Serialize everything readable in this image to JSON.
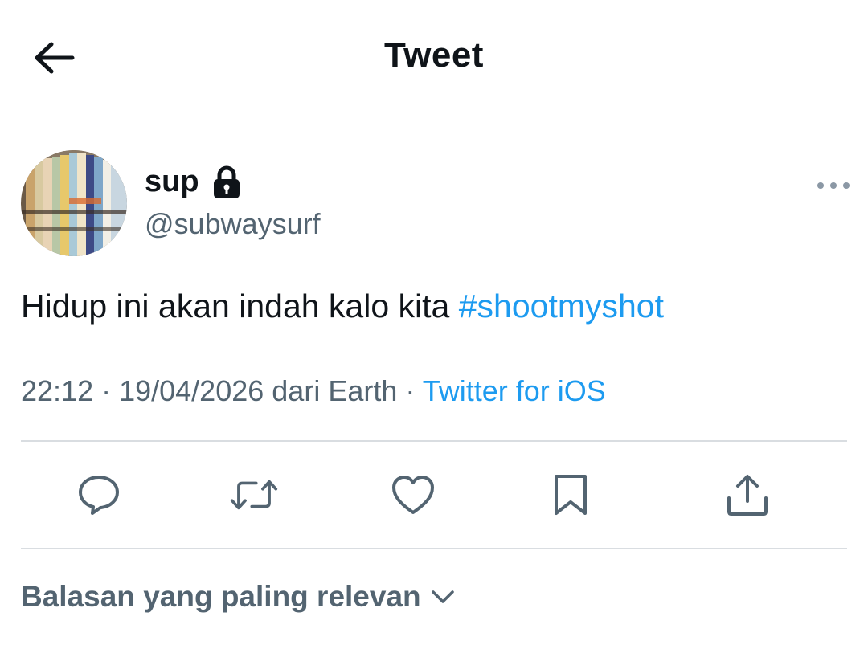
{
  "header": {
    "back_icon": "arrow-left-icon",
    "title": "Tweet"
  },
  "tweet": {
    "author": {
      "display_name": "sup",
      "handle": "@subwaysurf",
      "protected_icon": "lock-icon",
      "avatar": "avatar-surfboards-photo"
    },
    "more_icon": "more-horizontal-icon",
    "text": "Hidup ini akan indah kalo kita ",
    "hashtag": "#shootmyshot",
    "meta": {
      "time": "22:12",
      "separator1": " · ",
      "date": "19/04/2026",
      "location": " dari Earth",
      "separator2": " · ",
      "source": "Twitter for iOS"
    },
    "actions": [
      {
        "name": "reply",
        "icon": "reply-icon"
      },
      {
        "name": "retweet",
        "icon": "retweet-icon"
      },
      {
        "name": "like",
        "icon": "heart-icon"
      },
      {
        "name": "bookmark",
        "icon": "bookmark-icon"
      },
      {
        "name": "share",
        "icon": "share-icon"
      }
    ]
  },
  "replies": {
    "sort_label": "Balasan yang paling relevan",
    "sort_icon": "chevron-down-icon"
  },
  "colors": {
    "accent": "#1d9bf0",
    "text": "#0f1419",
    "secondary": "#536471",
    "divider": "#d9dde1"
  }
}
